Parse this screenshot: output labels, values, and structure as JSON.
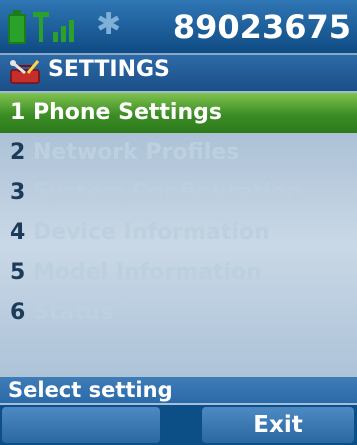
{
  "status": {
    "phone_number": "89023675",
    "battery_icon": "battery-icon",
    "signal_icon": "signal-antenna-icon",
    "bluetooth_icon": "bluetooth-icon"
  },
  "header": {
    "title": "SETTINGS",
    "icon": "settings-toolbox-icon"
  },
  "menu": {
    "items": [
      {
        "num": "1",
        "label": "Phone Settings",
        "selected": true
      },
      {
        "num": "2",
        "label": "Network Profiles",
        "selected": false
      },
      {
        "num": "3",
        "label": "System Configuration",
        "selected": false
      },
      {
        "num": "4",
        "label": "Device Information",
        "selected": false
      },
      {
        "num": "5",
        "label": "Model Information",
        "selected": false
      },
      {
        "num": "6",
        "label": "Status",
        "selected": false
      }
    ]
  },
  "footer": {
    "prompt": "Select setting",
    "left_softkey": "",
    "right_softkey": "Exit"
  },
  "colors": {
    "selection": "#3b8d25",
    "header_blue": "#1b4f88",
    "disabled_text": "#bcd0e0"
  }
}
